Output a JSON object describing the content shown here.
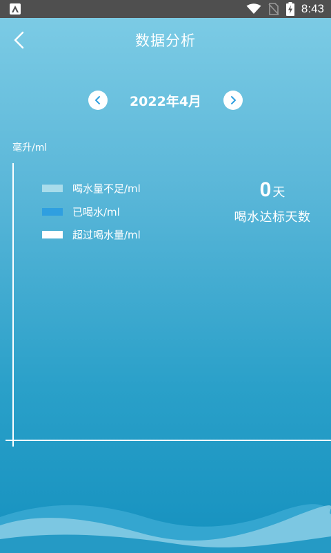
{
  "status_bar": {
    "time": "8:43",
    "icons": [
      "app-notification-icon",
      "wifi-icon",
      "no-sim-icon",
      "battery-charging-icon"
    ]
  },
  "header": {
    "title": "数据分析",
    "back_icon": "chevron-left-icon"
  },
  "month_nav": {
    "label": "2022年4月",
    "prev_icon": "chevron-left-circle-icon",
    "next_icon": "chevron-right-circle-icon"
  },
  "chart": {
    "unit_label": "毫升/ml",
    "legend": [
      {
        "label": "喝水量不足/ml",
        "color": "#a8dceb"
      },
      {
        "label": "已喝水/ml",
        "color": "#2f9fe0"
      },
      {
        "label": "超过喝水量/ml",
        "color": "#ffffff"
      }
    ]
  },
  "stat": {
    "value": "0",
    "unit": "天",
    "caption": "喝水达标天数"
  },
  "colors": {
    "status_bar": "#4f4f4f",
    "accent_blue": "#2f9fe0",
    "text": "#ffffff"
  }
}
